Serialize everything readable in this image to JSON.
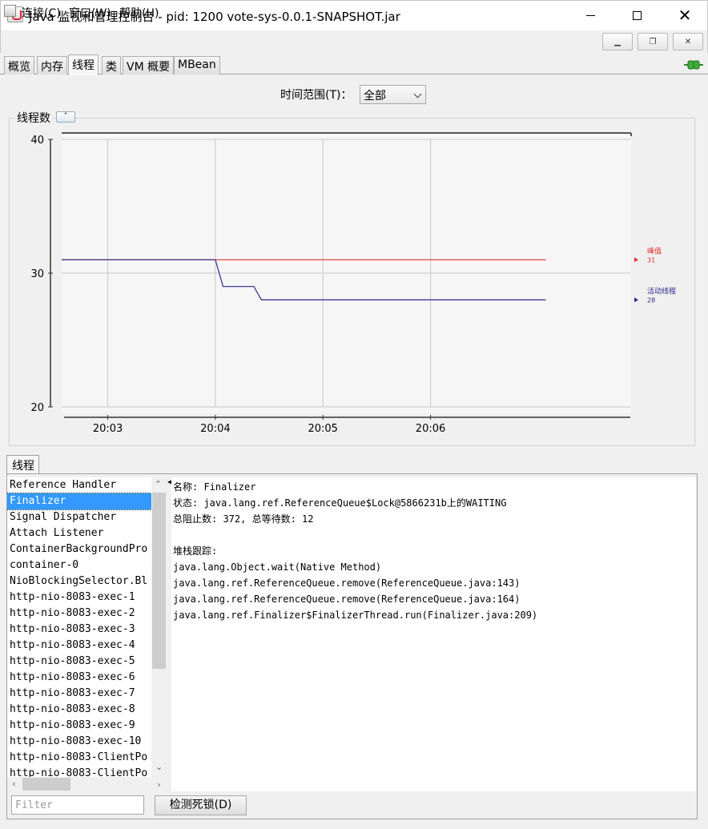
{
  "window": {
    "title": "Java 监视和管理控制台 - pid: 1200 vote-sys-0.0.1-SNAPSHOT.jar"
  },
  "menu": {
    "connect": "连接(C)",
    "window": "窗口(W)",
    "help": "帮助(H)"
  },
  "tabs": [
    "概览",
    "内存",
    "线程",
    "类",
    "VM 概要",
    "MBean"
  ],
  "active_tab": "线程",
  "time_range": {
    "label": "时间范围(T)：",
    "value": "全部"
  },
  "chart": {
    "panel_title": "线程数"
  },
  "chart_data": {
    "type": "line",
    "x": [
      "20:03",
      "20:04",
      "20:05",
      "20:06"
    ],
    "ylim": [
      20,
      40
    ],
    "y_ticks": [
      "20",
      "30",
      "40"
    ],
    "grid": true,
    "legend_placement": "right",
    "series": [
      {
        "name": "峰值",
        "color": "#e03030",
        "current": "31",
        "points": [
          [
            0,
            31
          ],
          [
            6.3,
            31
          ]
        ]
      },
      {
        "name": "活动线程",
        "color": "#2a2a8c",
        "current": "28",
        "points": [
          [
            0,
            31
          ],
          [
            2.0,
            31
          ],
          [
            2.1,
            29
          ],
          [
            2.5,
            29
          ],
          [
            2.6,
            28
          ],
          [
            6.3,
            28
          ]
        ]
      }
    ],
    "x_time_ticks": [
      [
        0.6,
        "20:03"
      ],
      [
        2.0,
        "20:04"
      ],
      [
        3.4,
        "20:05"
      ],
      [
        4.8,
        "20:06"
      ]
    ]
  },
  "threads": {
    "tab_label": "线程",
    "list": [
      "Reference Handler",
      "Finalizer",
      "Signal Dispatcher",
      "Attach Listener",
      "ContainerBackgroundPro",
      "container-0",
      "NioBlockingSelector.Bl",
      "http-nio-8083-exec-1",
      "http-nio-8083-exec-2",
      "http-nio-8083-exec-3",
      "http-nio-8083-exec-4",
      "http-nio-8083-exec-5",
      "http-nio-8083-exec-6",
      "http-nio-8083-exec-7",
      "http-nio-8083-exec-8",
      "http-nio-8083-exec-9",
      "http-nio-8083-exec-10",
      "http-nio-8083-ClientPo",
      "http-nio-8083-ClientPo"
    ],
    "selected": "Finalizer",
    "details": {
      "name": "名称: Finalizer",
      "state": "状态: java.lang.ref.ReferenceQueue$Lock@5866231b上的WAITING",
      "counts": "总阻止数: 372, 总等待数: 12",
      "stack_label": "堆栈跟踪:",
      "stack": [
        "java.lang.Object.wait(Native Method)",
        "java.lang.ref.ReferenceQueue.remove(ReferenceQueue.java:143)",
        "java.lang.ref.ReferenceQueue.remove(ReferenceQueue.java:164)",
        "java.lang.ref.Finalizer$FinalizerThread.run(Finalizer.java:209)"
      ]
    },
    "filter_placeholder": "Filter",
    "deadlock_button": "检测死锁(D)"
  }
}
